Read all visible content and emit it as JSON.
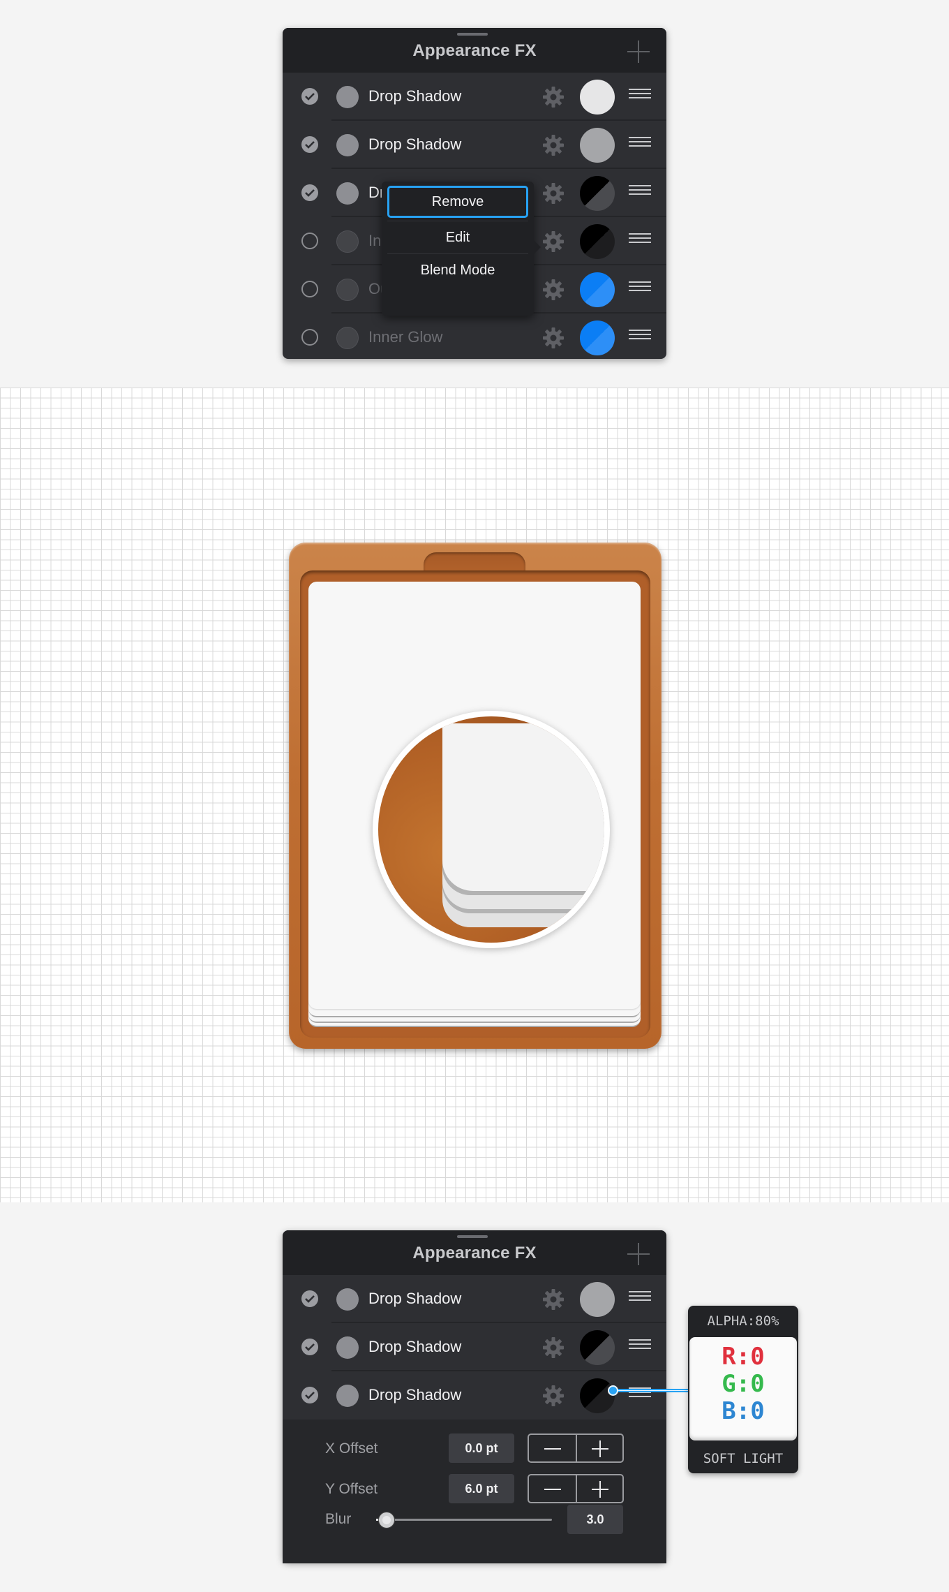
{
  "top_panel": {
    "title": "Appearance FX",
    "rows": [
      {
        "checked": true,
        "label": "Drop Shadow",
        "swatch": "white"
      },
      {
        "checked": true,
        "label": "Drop Shadow",
        "swatch": "gray"
      },
      {
        "checked": true,
        "label": "Drop Shadow",
        "swatch": "black-split"
      },
      {
        "checked": false,
        "label": "Inner Shadow",
        "swatch": "black"
      },
      {
        "checked": false,
        "label": "Outer Glow",
        "swatch": "blue"
      },
      {
        "checked": false,
        "label": "Inner Glow",
        "swatch": "blue"
      }
    ],
    "row_3_partial": "Dr",
    "row_4_partial": "In",
    "row_5_partial": "Ou",
    "context_menu": {
      "items": [
        "Remove",
        "Edit",
        "Blend Mode"
      ],
      "selected": "Remove"
    }
  },
  "bottom_panel": {
    "title": "Appearance FX",
    "rows": [
      {
        "checked": true,
        "label": "Drop Shadow",
        "swatch": "gray"
      },
      {
        "checked": true,
        "label": "Drop Shadow",
        "swatch": "black-split"
      },
      {
        "checked": true,
        "label": "Drop Shadow",
        "swatch": "black"
      }
    ],
    "x_offset": {
      "label": "X Offset",
      "value": "0.0 pt"
    },
    "y_offset": {
      "label": "Y Offset",
      "value": "6.0 pt"
    },
    "blur": {
      "label": "Blur",
      "value": "3.0",
      "slider_fraction": 0.06
    }
  },
  "color_tooltip": {
    "alpha": "ALPHA:80%",
    "r": "R:0",
    "g": "G:0",
    "b": "B:0",
    "blend": "SOFT LIGHT"
  },
  "colors": {
    "panel_bg": "#2e2f33",
    "accent_blue": "#27a2f3",
    "swatch_blue": "#0b7ef5",
    "wood": "#bf6f33"
  },
  "icons": {
    "check": "check-icon",
    "settings": "gear-icon",
    "drag": "drag-handle-icon",
    "add": "plus-icon"
  }
}
